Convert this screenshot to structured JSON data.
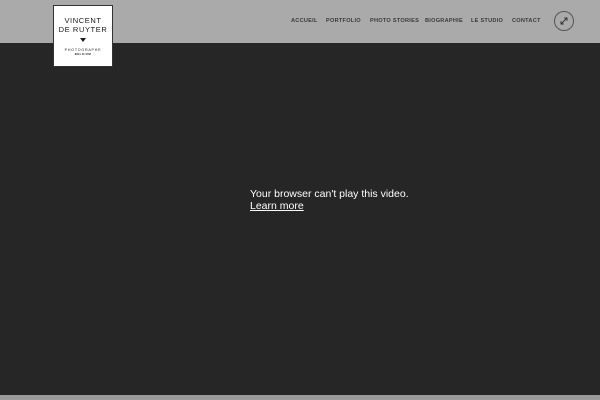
{
  "logo": {
    "first_name": "VINCENT",
    "last_name": "DE RUYTER",
    "role": "PHOTOGRAPHE",
    "country": "BELGIUM"
  },
  "nav": {
    "items": [
      {
        "label": "ACCUEIL"
      },
      {
        "label": "PORTFOLIO"
      },
      {
        "label": "PHOTO STORIES"
      },
      {
        "label": "BIOGRAPHIE"
      },
      {
        "label": "LE STUDIO"
      },
      {
        "label": "CONTACT"
      }
    ]
  },
  "toolbar": {
    "expand_icon": "expand-arrows-icon"
  },
  "video": {
    "message": "Your browser can't play this video.",
    "link_label": "Learn more"
  },
  "colors": {
    "header_bg": "#aaaaaa",
    "page_bg": "#262626",
    "nav_text": "#3a3a3a",
    "video_text": "#ffffff"
  }
}
